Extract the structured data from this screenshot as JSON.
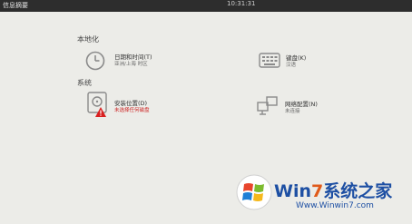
{
  "topbar": {
    "title": "信息摘要",
    "clock": "10:31:31"
  },
  "sections": {
    "localization": {
      "title": "本地化"
    },
    "system": {
      "title": "系统"
    }
  },
  "items": {
    "datetime": {
      "label": "日期和时间(T)",
      "status": "亚洲/上海 时区",
      "icon": "clock-icon"
    },
    "keyboard": {
      "label": "键盘(K)",
      "status": "汉语",
      "icon": "keyboard-icon"
    },
    "install_destination": {
      "label": "安装位置(D)",
      "status": "未选择任何磁盘",
      "icon": "disk-icon",
      "status_color": "#cc2222"
    },
    "network": {
      "label": "网络配置(N)",
      "status": "未连接",
      "icon": "network-icon"
    }
  },
  "watermark": {
    "brand_prefix": "Win",
    "brand_seven": "7",
    "brand_suffix": "系统之家",
    "url": "Www.Winwin7.com"
  }
}
